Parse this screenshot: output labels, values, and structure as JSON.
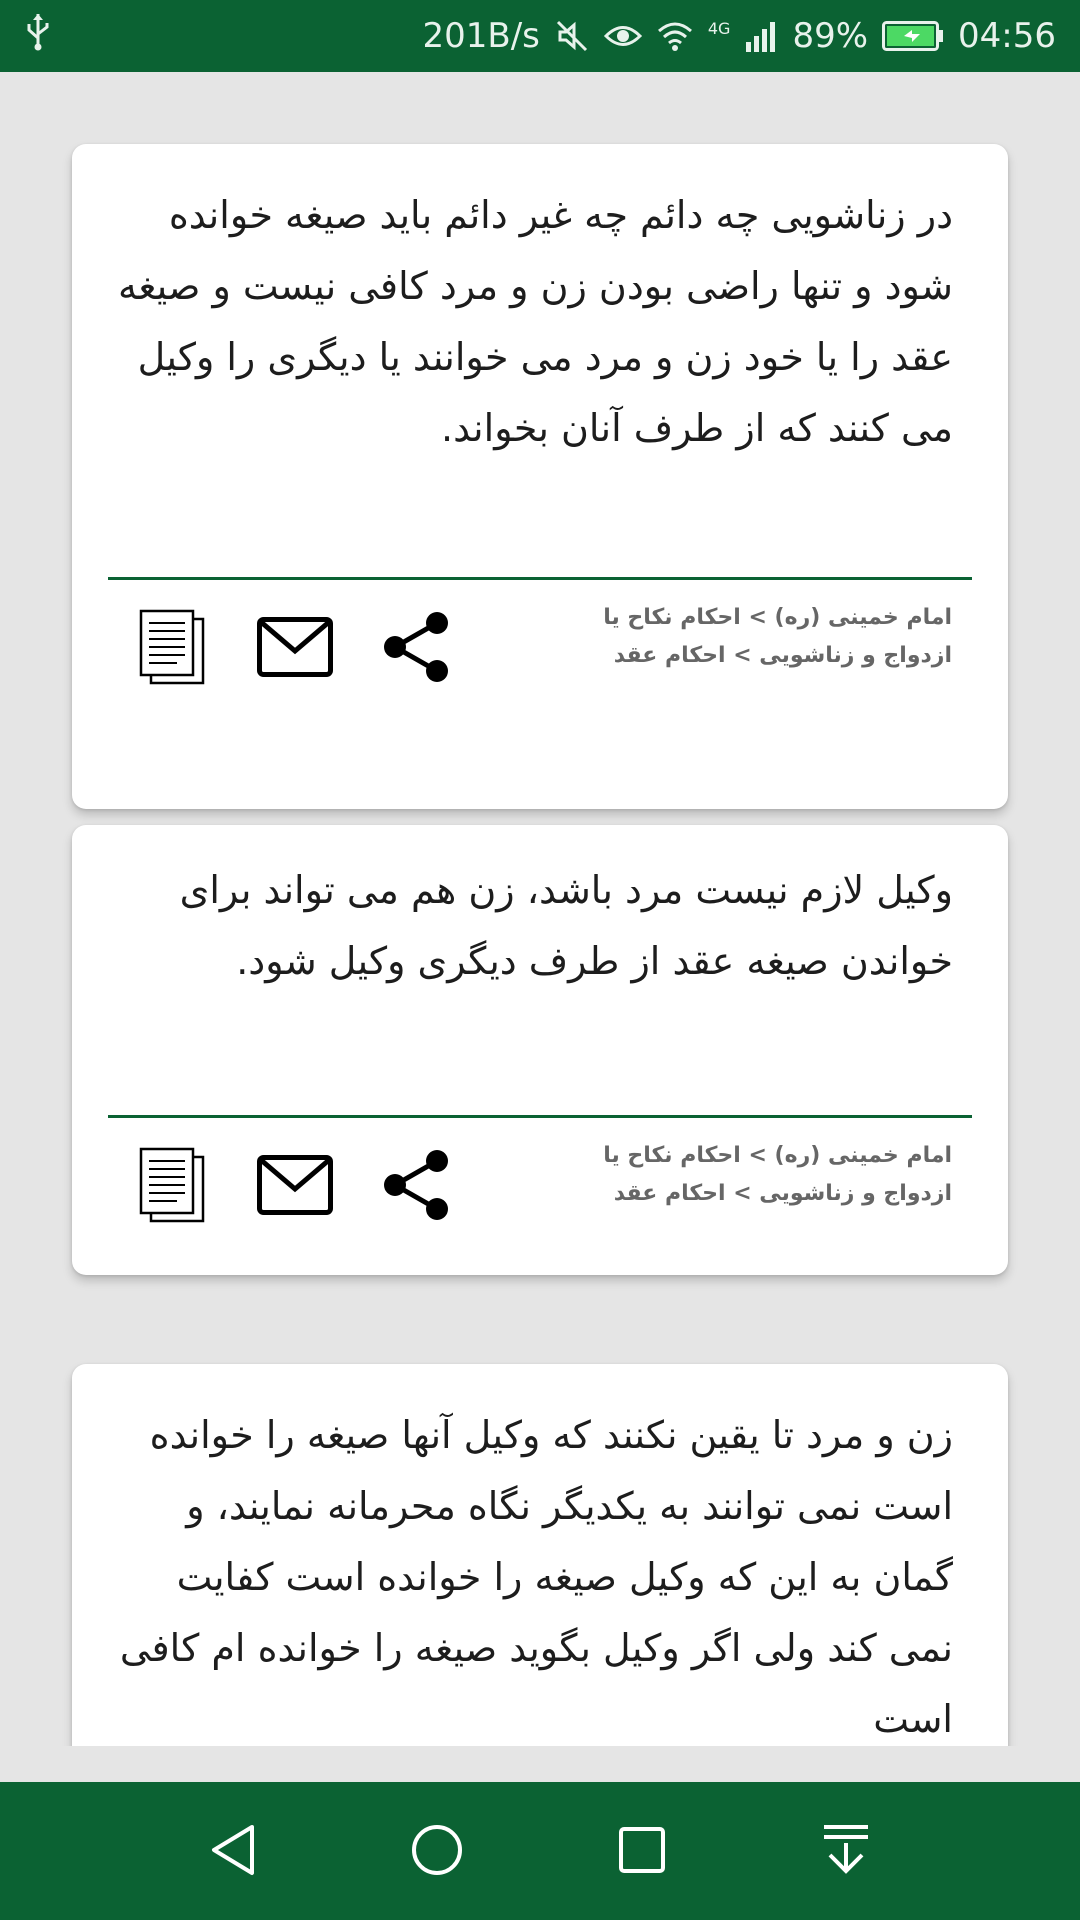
{
  "status_bar": {
    "net_speed": "201B/s",
    "network_type": "4G",
    "battery_percent": "89%",
    "time": "04:56",
    "icons": [
      "usb-icon",
      "mute-icon",
      "eye-icon",
      "wifi-icon",
      "signal-icon",
      "battery-charging-icon"
    ]
  },
  "cards": [
    {
      "text": "در زناشویی چه دائم چه غیر دائم باید صیغه خوانده شود و تنها راضی بودن زن و مرد کافی نیست و صیغه عقد را یا خود زن و مرد می خوانند یا دیگری را وکیل می کنند که از طرف آنان بخواند.",
      "source": "امام خمینی (ره) > احکام نکاح یا ازدواج و زناشویی > احکام عقد",
      "actions": [
        "copy-icon",
        "mail-icon",
        "share-icon"
      ]
    },
    {
      "text": "وکیل لازم نیست مرد باشد، زن هم می تواند برای خواندن صیغه عقد از طرف دیگری وکیل شود.",
      "source": "امام خمینی (ره) > احکام نکاح یا ازدواج و زناشویی > احکام عقد",
      "actions": [
        "copy-icon",
        "mail-icon",
        "share-icon"
      ]
    },
    {
      "text": "زن و مرد تا یقین نکنند که وکیل آنها صیغه را خوانده است نمی توانند به یکدیگر نگاه محرمانه نمایند، و گمان به این که وکیل صیغه را خوانده است کفایت نمی کند ولی اگر وکیل بگوید صیغه را خوانده ام کافی است"
    }
  ],
  "nav_bar": {
    "buttons": [
      "back-icon",
      "home-icon",
      "recents-icon",
      "notifications-pull-icon"
    ]
  },
  "colors": {
    "primary": "#0b6233",
    "background": "#e5e5e5",
    "card": "#ffffff",
    "text": "#1d1d1d",
    "source_text": "#666666"
  }
}
